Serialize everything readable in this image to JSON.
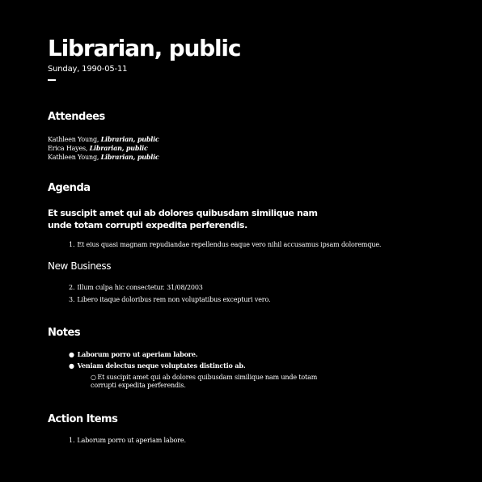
{
  "document": {
    "title": "Librarian, public",
    "date": "Sunday, 1990-05-11"
  },
  "attendees": {
    "heading": "Attendees",
    "people": [
      {
        "name": "Kathleen Young",
        "role": "Librarian, public"
      },
      {
        "name": "Erica Hayes",
        "role": "Librarian, public"
      },
      {
        "name": "Kathleen Young",
        "role": "Librarian, public"
      }
    ]
  },
  "agenda": {
    "heading": "Agenda",
    "subheading": "Et suscipit amet qui ab dolores quibusdam similique nam unde totam corrupti expedita perferendis.",
    "items": [
      {
        "num": "1.",
        "text": "Et eius quasi magnam repudiandae repellendus eaque vero nihil accusamus ipsam doloremque."
      }
    ],
    "new_business_heading": "New Business",
    "new_business_items": [
      {
        "num": "2.",
        "text": "Illum culpa hic consectetur. 31/08/2003"
      },
      {
        "num": "3.",
        "text": "Libero itaque doloribus rem non voluptatibus excepturi vero."
      }
    ]
  },
  "notes": {
    "heading": "Notes",
    "bullet": "●",
    "items": [
      "Laborum porro ut aperiam labore.",
      "Veniam delectus neque voluptates distinctio ab."
    ],
    "sub_bullet": "○",
    "sub_items": [
      "Et suscipit amet qui ab dolores quibusdam similique nam unde totam corrupti expedita perferendis."
    ]
  },
  "action_items": {
    "heading": "Action Items",
    "items": [
      {
        "num": "1.",
        "text": "Laborum porro ut aperiam labore."
      }
    ]
  }
}
